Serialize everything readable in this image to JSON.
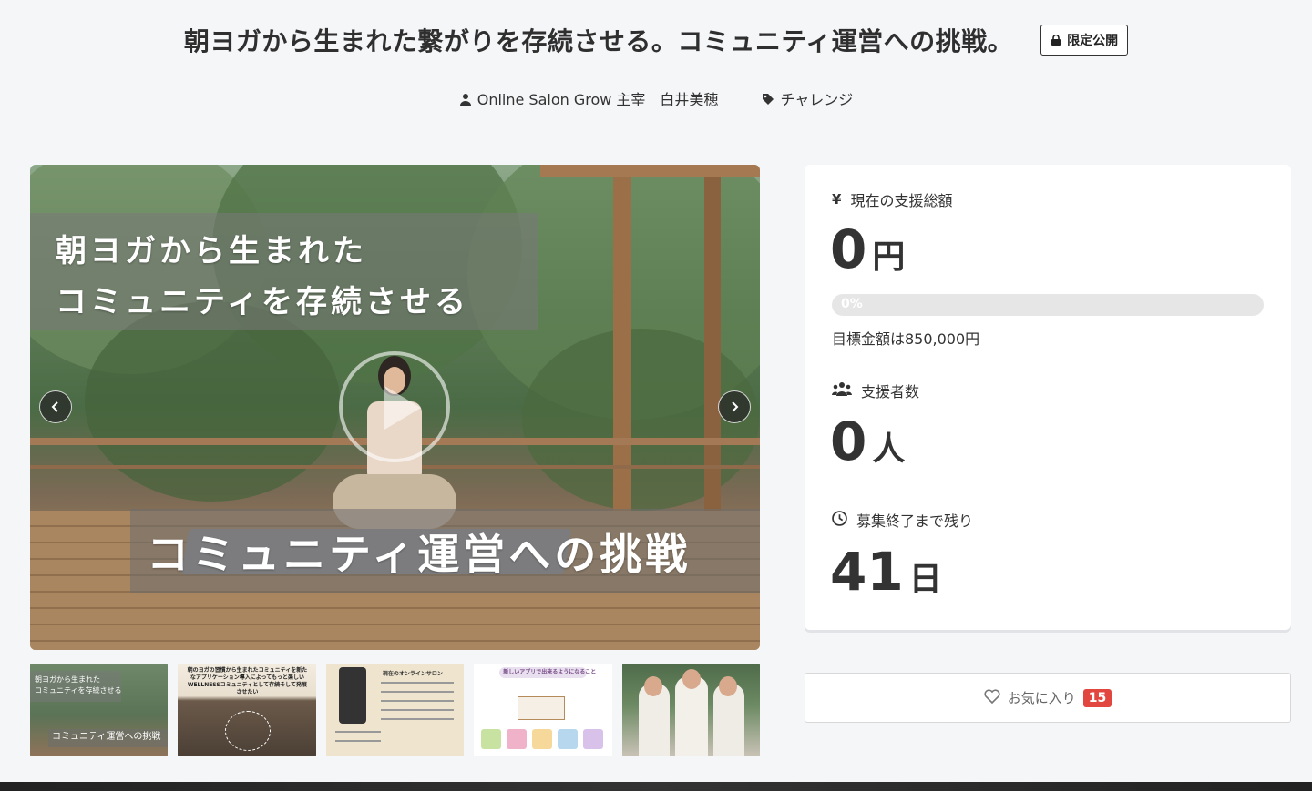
{
  "header": {
    "title": "朝ヨガから生まれた繋がりを存続させる。コミュニティ運営への挑戦。",
    "badge_label": "限定公開",
    "owner": "Online Salon Grow 主宰　白井美穂",
    "category": "チャレンジ"
  },
  "hero": {
    "overlay_line1": "朝ヨガから生まれた",
    "overlay_line2": "コミュニティを存続させる",
    "overlay_bottom": "コミュニティ運営への挑戦"
  },
  "thumbs": [
    {
      "label": "thumbnail-1",
      "line1": "朝ヨガから生まれた",
      "line2": "コミュニティを存続させる",
      "line3": "コミュニティ運営への挑戦"
    },
    {
      "label": "thumbnail-2",
      "text": "朝のヨガの習慣から生まれたコミュニティを新たなアプリケーション導入によってもっと楽しいWELLNESSコミュニティとして存続そして発展させたい"
    },
    {
      "label": "thumbnail-3",
      "text": "現在のオンラインサロン"
    },
    {
      "label": "thumbnail-4",
      "text": "新しいアプリで出来るようになること"
    },
    {
      "label": "thumbnail-5"
    }
  ],
  "stats": {
    "amount_label": "現在の支援総額",
    "amount_value": "0",
    "amount_unit": "円",
    "progress_text": "0%",
    "progress_fraction": 0,
    "goal_text": "目標金額は850,000円",
    "supporters_label": "支援者数",
    "supporters_value": "0",
    "supporters_unit": "人",
    "remaining_label": "募集終了まで残り",
    "remaining_value": "41",
    "remaining_unit": "日"
  },
  "favorite": {
    "label": "お気に入り",
    "count": "15"
  },
  "colors": {
    "accent_red": "#e2473f",
    "progress_bg": "#e6e6e6"
  }
}
